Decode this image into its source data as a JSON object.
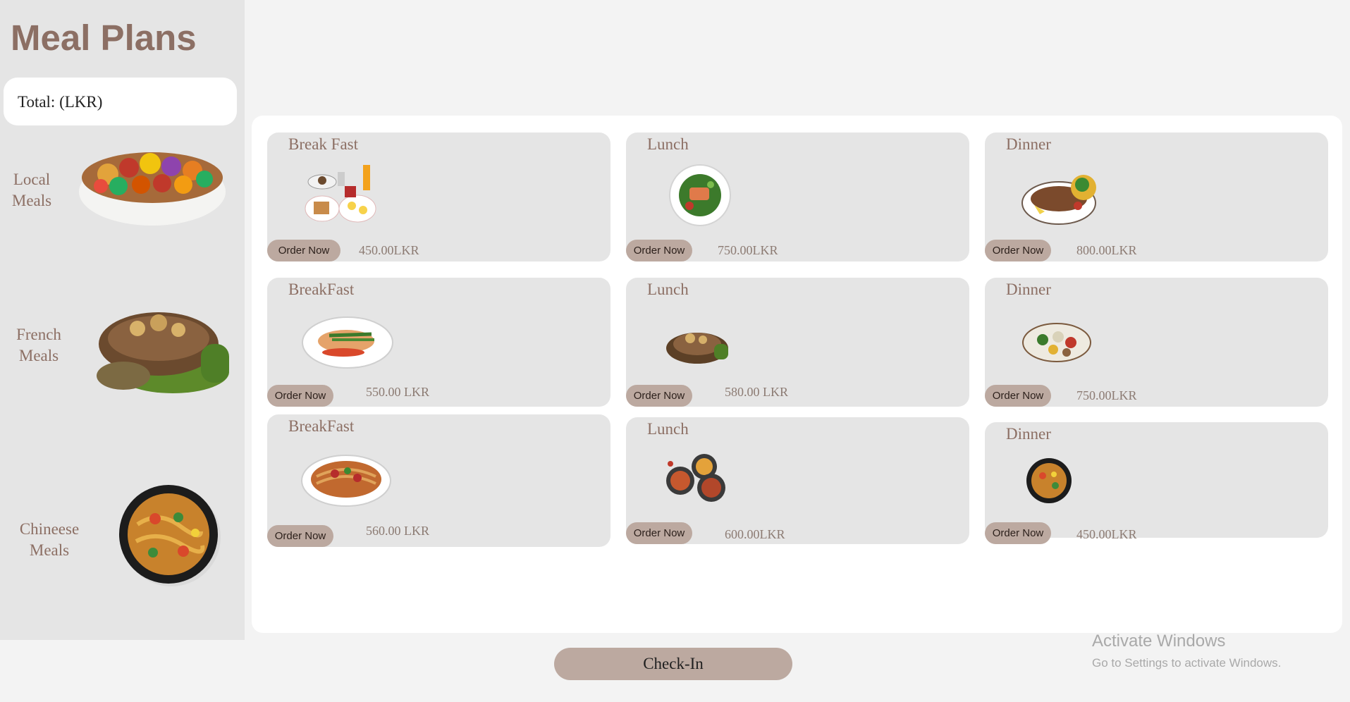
{
  "sidebar": {
    "title": "Meal Plans",
    "total_label": "Total: (LKR)",
    "categories": [
      {
        "label_line1": "Local",
        "label_line2": "Meals",
        "icon": "salad-bowl-icon"
      },
      {
        "label_line1": "French",
        "label_line2": "Meals",
        "icon": "grilled-steak-icon"
      },
      {
        "label_line1": "Chineese",
        "label_line2": "Meals",
        "icon": "noodle-pan-icon"
      }
    ]
  },
  "cards": {
    "row1": [
      {
        "title": "Break Fast",
        "order": "Order Now",
        "price": "450.00LKR"
      },
      {
        "title": "Lunch",
        "order": "Order Now",
        "price": "750.00LKR"
      },
      {
        "title": "Dinner",
        "order": "Order Now",
        "price": "800.00LKR"
      }
    ],
    "row2": [
      {
        "title": "BreakFast",
        "order": "Order Now",
        "price": "550.00 LKR"
      },
      {
        "title": "Lunch",
        "order": "Order Now",
        "price": "580.00 LKR"
      },
      {
        "title": "Dinner",
        "order": "Order Now",
        "price": "750.00LKR"
      }
    ],
    "row3": [
      {
        "title": "BreakFast",
        "order": "Order Now",
        "price": "560.00 LKR"
      },
      {
        "title": "Lunch",
        "order": "Order Now",
        "price": "600.00LKR"
      },
      {
        "title": "Dinner",
        "order": "Order Now",
        "price": "450.00LKR"
      }
    ]
  },
  "footer": {
    "checkin_label": "Check-In"
  },
  "os_watermark": {
    "title": "Activate Windows",
    "subtitle": "Go to Settings to activate Windows."
  },
  "colors": {
    "brand": "#8c6f64",
    "button": "#bca9a0",
    "card_bg": "#e5e5e5"
  }
}
